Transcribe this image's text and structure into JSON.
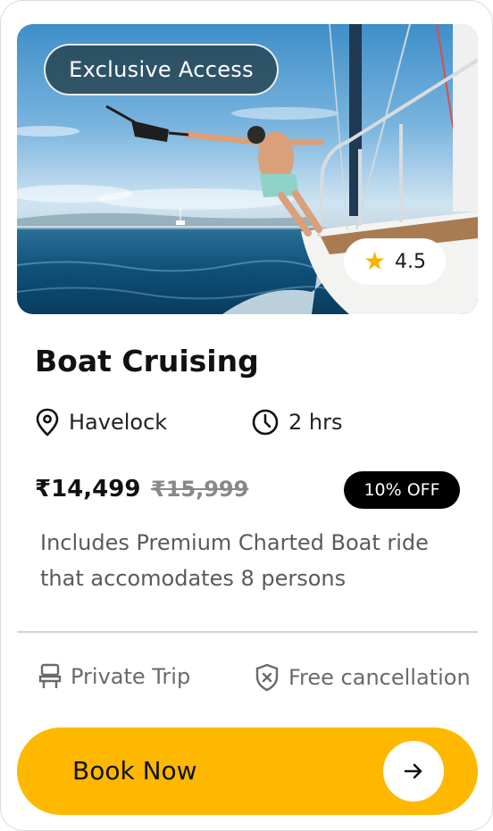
{
  "card": {
    "badge": "Exclusive Access",
    "rating": "4.5",
    "title": "Boat Cruising",
    "location": "Havelock",
    "duration": "2 hrs",
    "price": "₹14,499",
    "original_price": "₹15,999",
    "discount": "10% OFF",
    "description": "Includes Premium Charted Boat ride that accomodates 8 persons",
    "features": [
      {
        "label": "Private Trip",
        "icon": "seat-icon"
      },
      {
        "label": "Free cancellation",
        "icon": "shield-x-icon"
      }
    ],
    "cta_label": "Book Now"
  },
  "colors": {
    "accent": "#ffb800",
    "discount_bg": "#000000",
    "badge_bg": "#233e48",
    "star": "#f5b400"
  }
}
